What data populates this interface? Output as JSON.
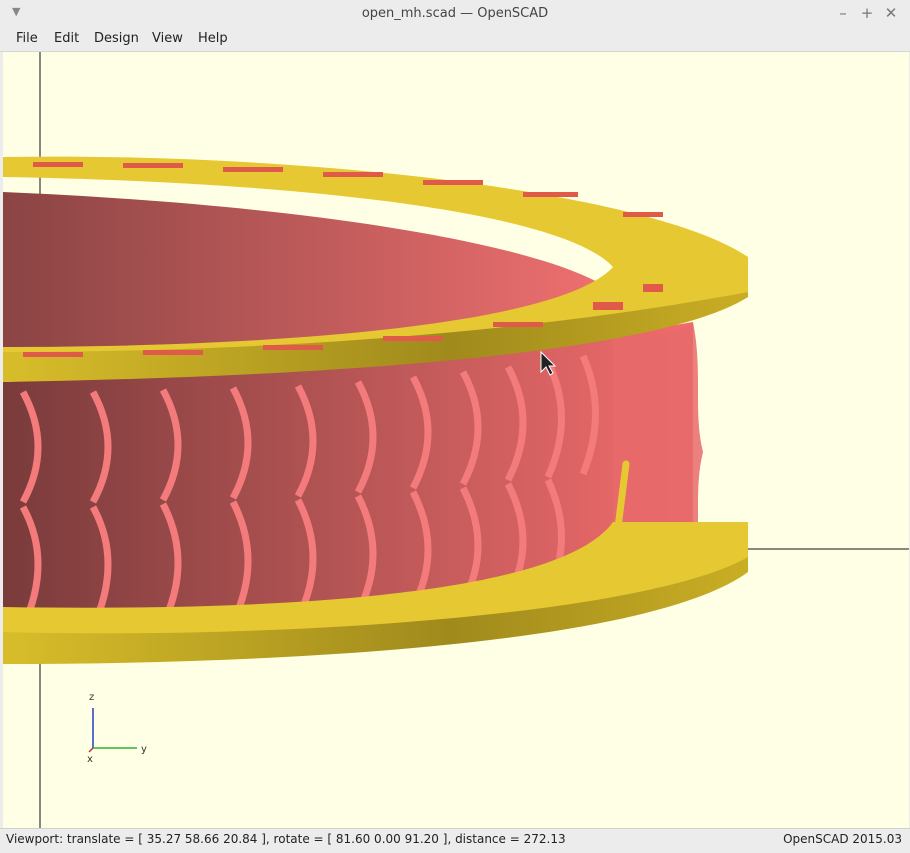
{
  "window": {
    "title": "open_mh.scad — OpenSCAD",
    "minimize_glyph": "–",
    "maximize_glyph": "+",
    "close_glyph": "✕"
  },
  "menu": {
    "items": [
      {
        "label": "File"
      },
      {
        "label": "Edit"
      },
      {
        "label": "Design"
      },
      {
        "label": "View"
      },
      {
        "label": "Help"
      }
    ]
  },
  "viewport": {
    "background": "#ffffe5",
    "ring_color": "#e6c832",
    "fin_color": "#f07070",
    "axis_indicator": {
      "z": "z",
      "y": "y",
      "x": "x"
    }
  },
  "status": {
    "viewport_text": "Viewport: translate = [ 35.27 58.66 20.84 ], rotate = [ 81.60 0.00 91.20 ], distance = 272.13",
    "version": "OpenSCAD 2015.03"
  }
}
